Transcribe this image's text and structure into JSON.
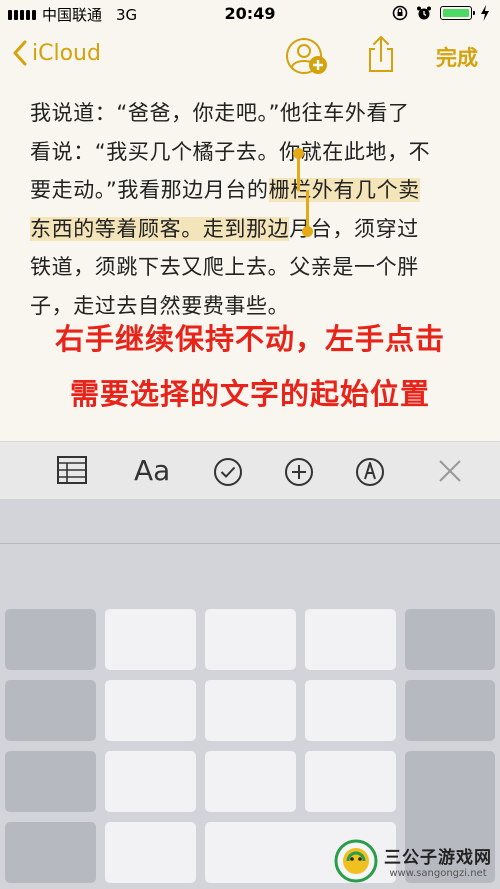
{
  "status_bar": {
    "carrier": "中国联通",
    "network": "3G",
    "time": "20:49",
    "battery_color": "#4cd964"
  },
  "nav": {
    "back_label": "iCloud",
    "done_label": "完成",
    "accent_color": "#d4a20c",
    "icons": [
      "add-person-icon",
      "share-icon"
    ]
  },
  "note": {
    "line1": "我说道：“爸爸，你走吧。”他往车外看了",
    "line2": "看说：“我买几个橘子去。你就在此地，不",
    "line3_before": "要走动。”我看那边月台的",
    "line3_selected": "栅栏外有几个卖",
    "line4_selected": "东西的等着顾客。走到那边",
    "line4_after": "月台，须穿过",
    "line5": "铁道，须跳下去又爬上去。父亲是一个胖",
    "line6": "子，走过去自然要费事些。"
  },
  "instruction": {
    "line1": "右手继续保持不动，左手点击",
    "line2": "需要选择的文字的起始位置",
    "color": "#e8231a"
  },
  "format_toolbar": {
    "icons": [
      "table-icon",
      "text-format-icon",
      "checklist-icon",
      "insert-icon",
      "markup-icon",
      "close-icon"
    ],
    "text_format_label": "Aa"
  },
  "watermark": {
    "title": "三公子游戏网",
    "url": "www.sangongzi.net"
  }
}
